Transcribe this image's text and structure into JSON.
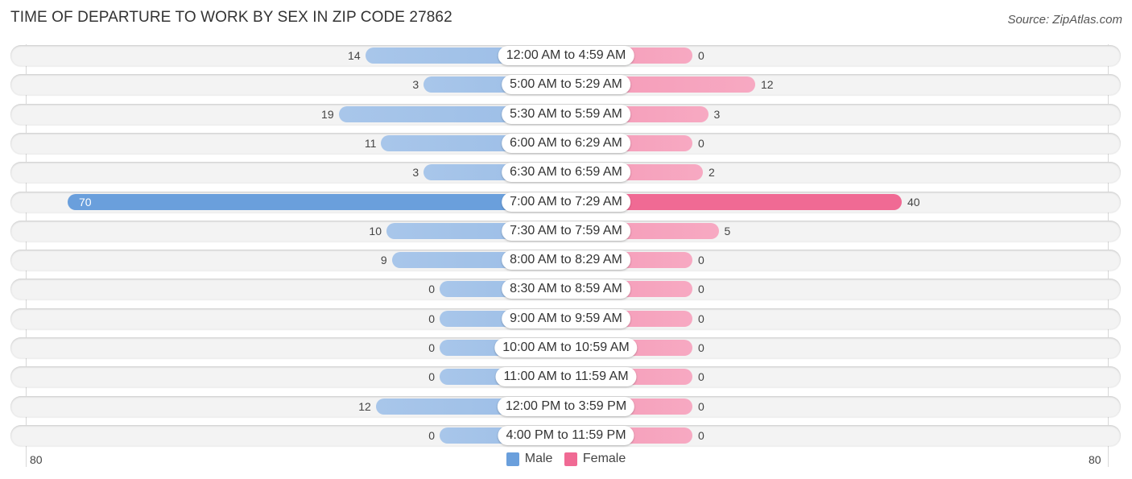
{
  "header": {
    "title": "TIME OF DEPARTURE TO WORK BY SEX IN ZIP CODE 27862",
    "source": "Source: ZipAtlas.com"
  },
  "colors": {
    "male": "#9bbde6",
    "male_highlight": "#6a9fdc",
    "female": "#f7a9c2",
    "female_highlight": "#f06a94"
  },
  "chart_data": {
    "type": "bar",
    "orientation": "horizontal-diverging",
    "title": "TIME OF DEPARTURE TO WORK BY SEX IN ZIP CODE 27862",
    "categories": [
      "12:00 AM to 4:59 AM",
      "5:00 AM to 5:29 AM",
      "5:30 AM to 5:59 AM",
      "6:00 AM to 6:29 AM",
      "6:30 AM to 6:59 AM",
      "7:00 AM to 7:29 AM",
      "7:30 AM to 7:59 AM",
      "8:00 AM to 8:29 AM",
      "8:30 AM to 8:59 AM",
      "9:00 AM to 9:59 AM",
      "10:00 AM to 10:59 AM",
      "11:00 AM to 11:59 AM",
      "12:00 PM to 3:59 PM",
      "4:00 PM to 11:59 PM"
    ],
    "series": [
      {
        "name": "Male",
        "values": [
          14,
          3,
          19,
          11,
          3,
          70,
          10,
          9,
          0,
          0,
          0,
          0,
          12,
          0
        ]
      },
      {
        "name": "Female",
        "values": [
          0,
          12,
          3,
          0,
          2,
          40,
          5,
          0,
          0,
          0,
          0,
          0,
          0,
          0
        ]
      }
    ],
    "xlim": [
      -80,
      80
    ],
    "axis_labels": {
      "left": "80",
      "right": "80"
    },
    "legend": {
      "position": "bottom-center",
      "entries": [
        "Male",
        "Female"
      ]
    },
    "grid": false
  }
}
